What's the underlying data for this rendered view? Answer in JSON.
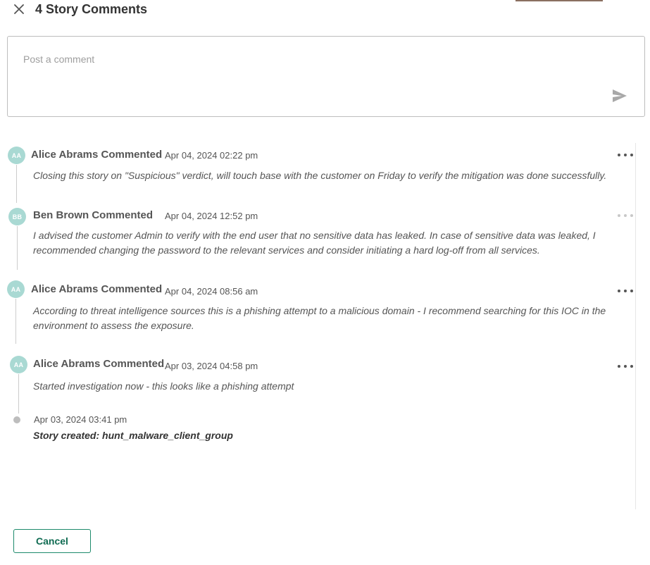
{
  "header": {
    "title": "4 Story Comments",
    "close_icon": "close-icon"
  },
  "composer": {
    "placeholder": "Post a comment",
    "value": "",
    "send_icon": "send-icon"
  },
  "comments": [
    {
      "initials": "AA",
      "author": "Alice Abrams Commented",
      "timestamp": "Apr 04, 2024 02:22 pm",
      "text": "Closing this story on \"Suspicious\" verdict, will touch base with the customer on Friday to verify the mitigation was done successfully."
    },
    {
      "initials": "BB",
      "author": "Ben Brown Commented",
      "timestamp": "Apr 04, 2024 12:52 pm",
      "text": "I advised the customer Admin to verify with the end user that no sensitive data has leaked. In case of sensitive data was leaked, I recommended changing the password to the relevant services and consider initiating a hard log-off from all services."
    },
    {
      "initials": "AA",
      "author": "Alice Abrams Commented",
      "timestamp": "Apr 04, 2024 08:56 am",
      "text": "According to threat intelligence sources this is a phishing attempt to a malicious domain - I recommend searching for this IOC in the environment to assess the exposure."
    },
    {
      "initials": "AA",
      "author": "Alice Abrams Commented",
      "timestamp": "Apr 03, 2024 04:58 pm",
      "text": "Started investigation now - this looks like a phishing attempt"
    }
  ],
  "event": {
    "timestamp": "Apr 03, 2024 03:41 pm",
    "text": "Story created: hunt_malware_client_group"
  },
  "footer": {
    "cancel_label": "Cancel"
  },
  "colors": {
    "avatar": "#a9d9d3",
    "accent": "#1d8a6b"
  }
}
